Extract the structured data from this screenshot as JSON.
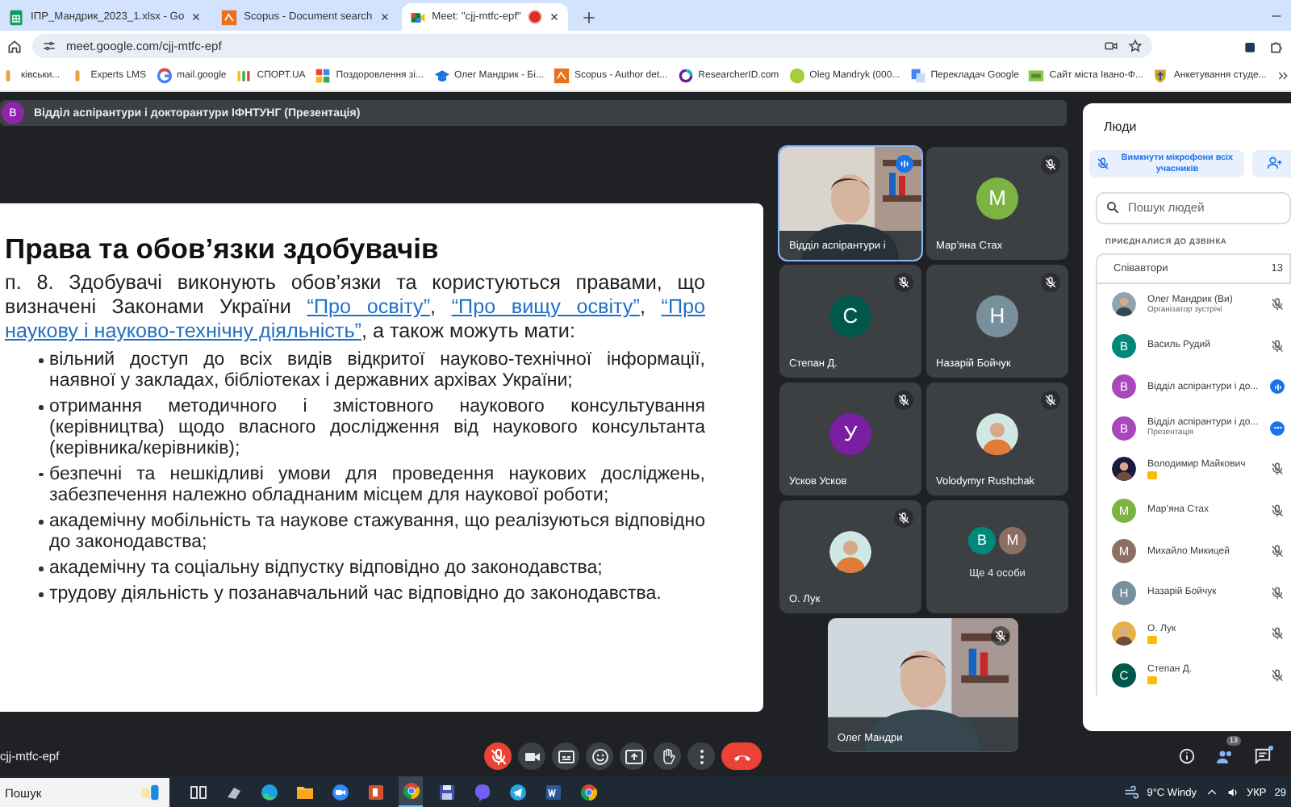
{
  "browser": {
    "tabs": [
      {
        "title": "ІПР_Мандрик_2023_1.xlsx - Go",
        "selected": false,
        "recording": false
      },
      {
        "title": "Scopus - Document search",
        "selected": false,
        "recording": false
      },
      {
        "title": "Meet: \"cjj-mtfc-epf\"",
        "selected": true,
        "recording": true
      }
    ],
    "url": "meet.google.com/cjj-mtfc-epf",
    "bookmarks": [
      "ківськи...",
      "Experts LMS",
      "mail.google",
      "СПОРТ.UA",
      "Поздоровлення зі...",
      "Олег Мандрик - Бі...",
      "Scopus - Author det...",
      "ResearcherID.com",
      "Oleg Mandryk (000...",
      "Перекладач Google",
      "Сайт міста Івано-Ф...",
      "Анкетування студе..."
    ]
  },
  "meeting": {
    "title": "Відділ аспірантури і докторантури ІФНТУНГ (Презентація)",
    "avatar": {
      "letter": "В",
      "color": "#8e24aa"
    }
  },
  "slide": {
    "title": "Права та обов’язки здобувачів",
    "paragraph": [
      {
        "kind": "text",
        "text": "п. 8. Здобувачі виконують обов’язки та користуються правами, що визначені Законами України "
      },
      {
        "kind": "link",
        "text": "“Про освіту”"
      },
      {
        "kind": "text",
        "text": ", "
      },
      {
        "kind": "link",
        "text": "“Про вищу освіту”"
      },
      {
        "kind": "text",
        "text": ", "
      },
      {
        "kind": "link",
        "text": "“Про"
      },
      {
        "kind": "link",
        "text": "наукову і науково-технічну діяльність”"
      },
      {
        "kind": "text",
        "text": ", а також можуть мати:"
      }
    ],
    "bullets": [
      "вільний доступ до всіх видів відкритої науково-технічної інформації, наявної у закладах, бібліотеках і державних архівах України;",
      "отримання методичного і змістовного наукового консультування (керівництва) щодо власного дослідження від наукового консультанта (керівника/керівників);",
      "безпечні та нешкідливі умови для проведення наукових досліджень, забезпечення належно обладнаним місцем для наукової роботи;",
      "академічну мобільність та наукове стажування, що реалізуються відповідно до законодавства;",
      "академічну та соціальну відпустку відповідно до законодавства;",
      "трудову діяльність у позанавчальний час відповідно до законодавства."
    ]
  },
  "tiles": [
    {
      "kind": "video",
      "name": "Відділ аспірантури і",
      "speaking": true,
      "muted": false
    },
    {
      "kind": "letter",
      "letter": "М",
      "color": "#7cb342",
      "name": "Мар’яна Стах",
      "speaking": false,
      "muted": true
    },
    {
      "kind": "letter",
      "letter": "С",
      "color": "#00574b",
      "name": "Степан Д.",
      "speaking": false,
      "muted": true
    },
    {
      "kind": "letter",
      "letter": "Н",
      "color": "#78909c",
      "name": "Назарій Бойчук",
      "speaking": false,
      "muted": true
    },
    {
      "kind": "letter",
      "letter": "У",
      "color": "#7b1fa2",
      "name": "Усков Усков",
      "speaking": false,
      "muted": true
    },
    {
      "name": "Volodymyr Rushchak",
      "speaking": false,
      "muted": true
    },
    {
      "name": "О. Лук",
      "speaking": false,
      "muted": true
    },
    {
      "kind": "group",
      "letters": [
        {
          "letter": "В",
          "color": "#00897b"
        },
        {
          "letter": "М",
          "color": "#8d6e63"
        }
      ],
      "name": "Ще 4 особи",
      "speaking": false,
      "muted": false
    }
  ],
  "self_tile": {
    "kind": "video",
    "name": "Олег Мандри",
    "speaking": false,
    "muted": true
  },
  "people_panel": {
    "title": "Люди",
    "mute_all": "Вимкнути мікрофони всіх учасників",
    "search_placeholder": "Пошук людей",
    "section": "ПРИЄДНАЛИСЯ ДО ДЗВІНКА",
    "group": "Співавтори",
    "count": "13",
    "people": [
      {
        "name": "Олег Мандрик (Ви)",
        "subtitle": "Організатор зустрічі",
        "badge": false,
        "kind": "muted"
      },
      {
        "name": "Василь Рудий",
        "letter": "В",
        "color": "#00897b",
        "badge": false,
        "kind": "muted"
      },
      {
        "name": "Відділ аспірантури і до...",
        "letter": "В",
        "color": "#ab47bc",
        "badge": false,
        "kind": "speaking"
      },
      {
        "name": "Відділ аспірантури і до...",
        "subtitle": "Презентація",
        "letter": "В",
        "color": "#ab47bc",
        "badge": false,
        "kind": "more"
      },
      {
        "name": "Володимир Майкович",
        "badge": true,
        "kind": "muted"
      },
      {
        "name": "Мар’яна Стах",
        "letter": "М",
        "color": "#7cb342",
        "badge": false,
        "kind": "muted"
      },
      {
        "name": "Михайло Микицей",
        "letter": "М",
        "color": "#8d6e63",
        "badge": false,
        "kind": "muted"
      },
      {
        "name": "Назарій Бойчук",
        "letter": "Н",
        "color": "#78909c",
        "badge": false,
        "kind": "muted"
      },
      {
        "name": "О. Лук",
        "badge": true,
        "kind": "muted"
      },
      {
        "name": "Степан Д.",
        "letter": "С",
        "color": "#00574b",
        "badge": true,
        "kind": "muted"
      }
    ]
  },
  "controls": {
    "meeting_code": "cjj-mtfc-epf",
    "buttons": [
      {
        "kind": "mic_off"
      },
      {
        "kind": "camera"
      },
      {
        "kind": "captions"
      },
      {
        "kind": "emoji"
      },
      {
        "kind": "present"
      },
      {
        "kind": "hand"
      },
      {
        "kind": "more"
      },
      {
        "kind": "end_call"
      }
    ],
    "people_count": "13",
    "chat_unread": true
  },
  "taskbar": {
    "search_placeholder": "Пошук",
    "apps": [
      {
        "kind": "taskview",
        "active": false
      },
      {
        "kind": "generic",
        "active": false
      },
      {
        "kind": "edge",
        "active": false
      },
      {
        "kind": "folder",
        "active": false
      },
      {
        "kind": "zoom",
        "active": false
      },
      {
        "kind": "powerpoint",
        "active": false
      },
      {
        "kind": "chrome",
        "active": true
      },
      {
        "kind": "save",
        "active": false
      },
      {
        "kind": "viber",
        "active": false
      },
      {
        "kind": "telegram",
        "active": false
      },
      {
        "kind": "word",
        "active": false
      },
      {
        "kind": "chrome",
        "active": false
      }
    ],
    "weather": "9°C Windy",
    "language": "УКР",
    "clock": "29"
  }
}
